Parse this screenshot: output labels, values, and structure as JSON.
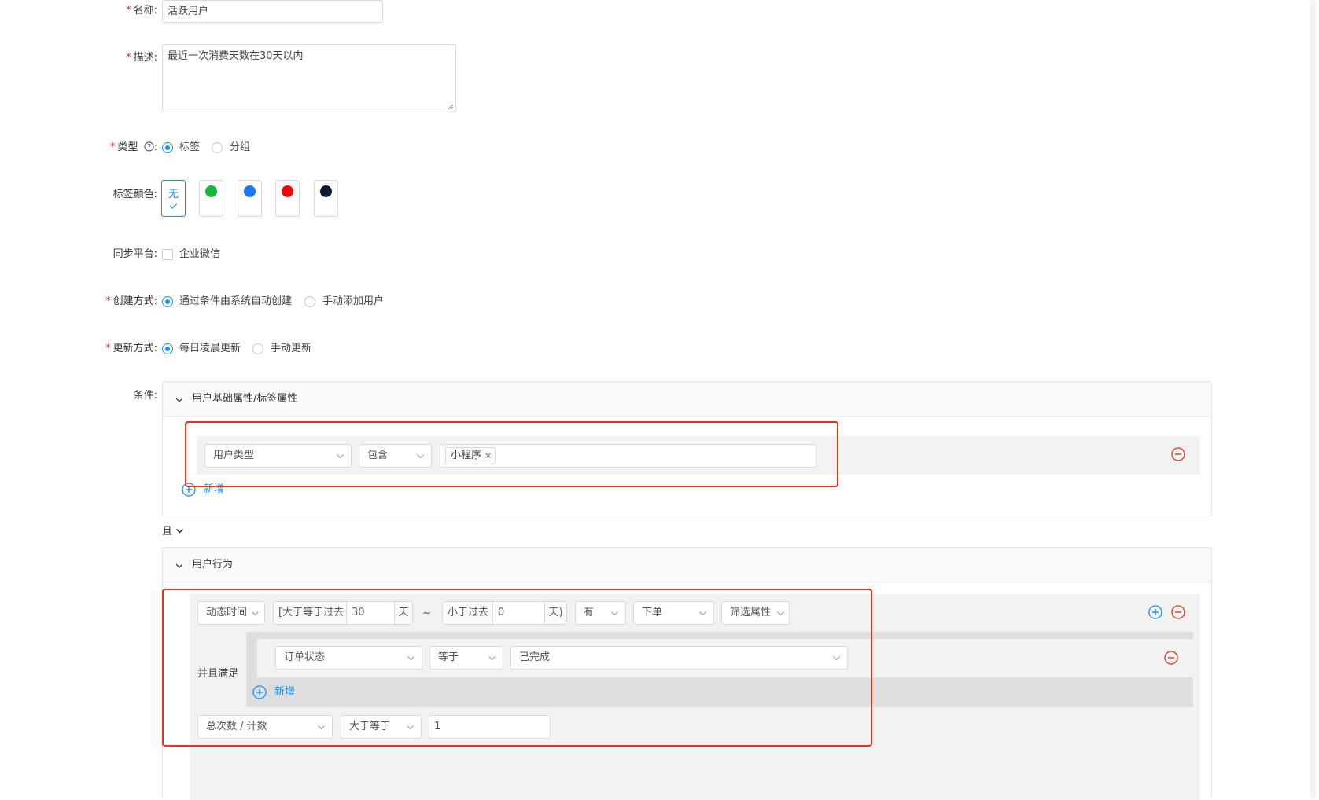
{
  "form": {
    "name": {
      "label": "名称:",
      "value": "活跃用户"
    },
    "description": {
      "label": "描述:",
      "value": "最近一次消费天数在30天以内"
    },
    "type": {
      "label": "类型",
      "colon": ":",
      "options": [
        "标签",
        "分组"
      ],
      "selected": "标签"
    },
    "tag_color": {
      "label": "标签颜色:",
      "none_label": "无",
      "selected": "无",
      "colors": [
        "#19b73a",
        "#1677ff",
        "#f5010a",
        "#0e1a33"
      ]
    },
    "sync_platform": {
      "label": "同步平台:",
      "option": "企业微信",
      "checked": false
    },
    "create_mode": {
      "label": "创建方式:",
      "options": [
        "通过条件由系统自动创建",
        "手动添加用户"
      ],
      "selected": "通过条件由系统自动创建"
    },
    "update_mode": {
      "label": "更新方式:",
      "options": [
        "每日凌晨更新",
        "手动更新"
      ],
      "selected": "每日凌晨更新"
    },
    "conditions": {
      "label": "条件:",
      "basic_panel": {
        "title": "用户基础属性/标签属性",
        "row": {
          "field": "用户类型",
          "operator": "包含",
          "tags": [
            "小程序"
          ]
        },
        "add_label": "新增"
      },
      "logic": "且",
      "behavior_panel": {
        "title": "用户行为",
        "time_field": "动态时间",
        "from_prefix": "[大于等于过去",
        "from_value": "30",
        "from_unit": "天",
        "range_sep": "~",
        "to_prefix": "小于过去",
        "to_value": "0",
        "to_unit": "天)",
        "has": "有",
        "event": "下单",
        "filter_attr": "筛选属性",
        "and_label": "并且满足",
        "sub_row": {
          "field": "订单状态",
          "operator": "等于",
          "value": "已完成"
        },
        "sub_add_label": "新增",
        "metric": "总次数 / 计数",
        "metric_operator": "大于等于",
        "metric_value": "1"
      }
    }
  },
  "colors": {
    "accent": "#1890ff",
    "required": "#f5222d",
    "highlight_box": "#e8321c",
    "remove": "#e8321c"
  }
}
